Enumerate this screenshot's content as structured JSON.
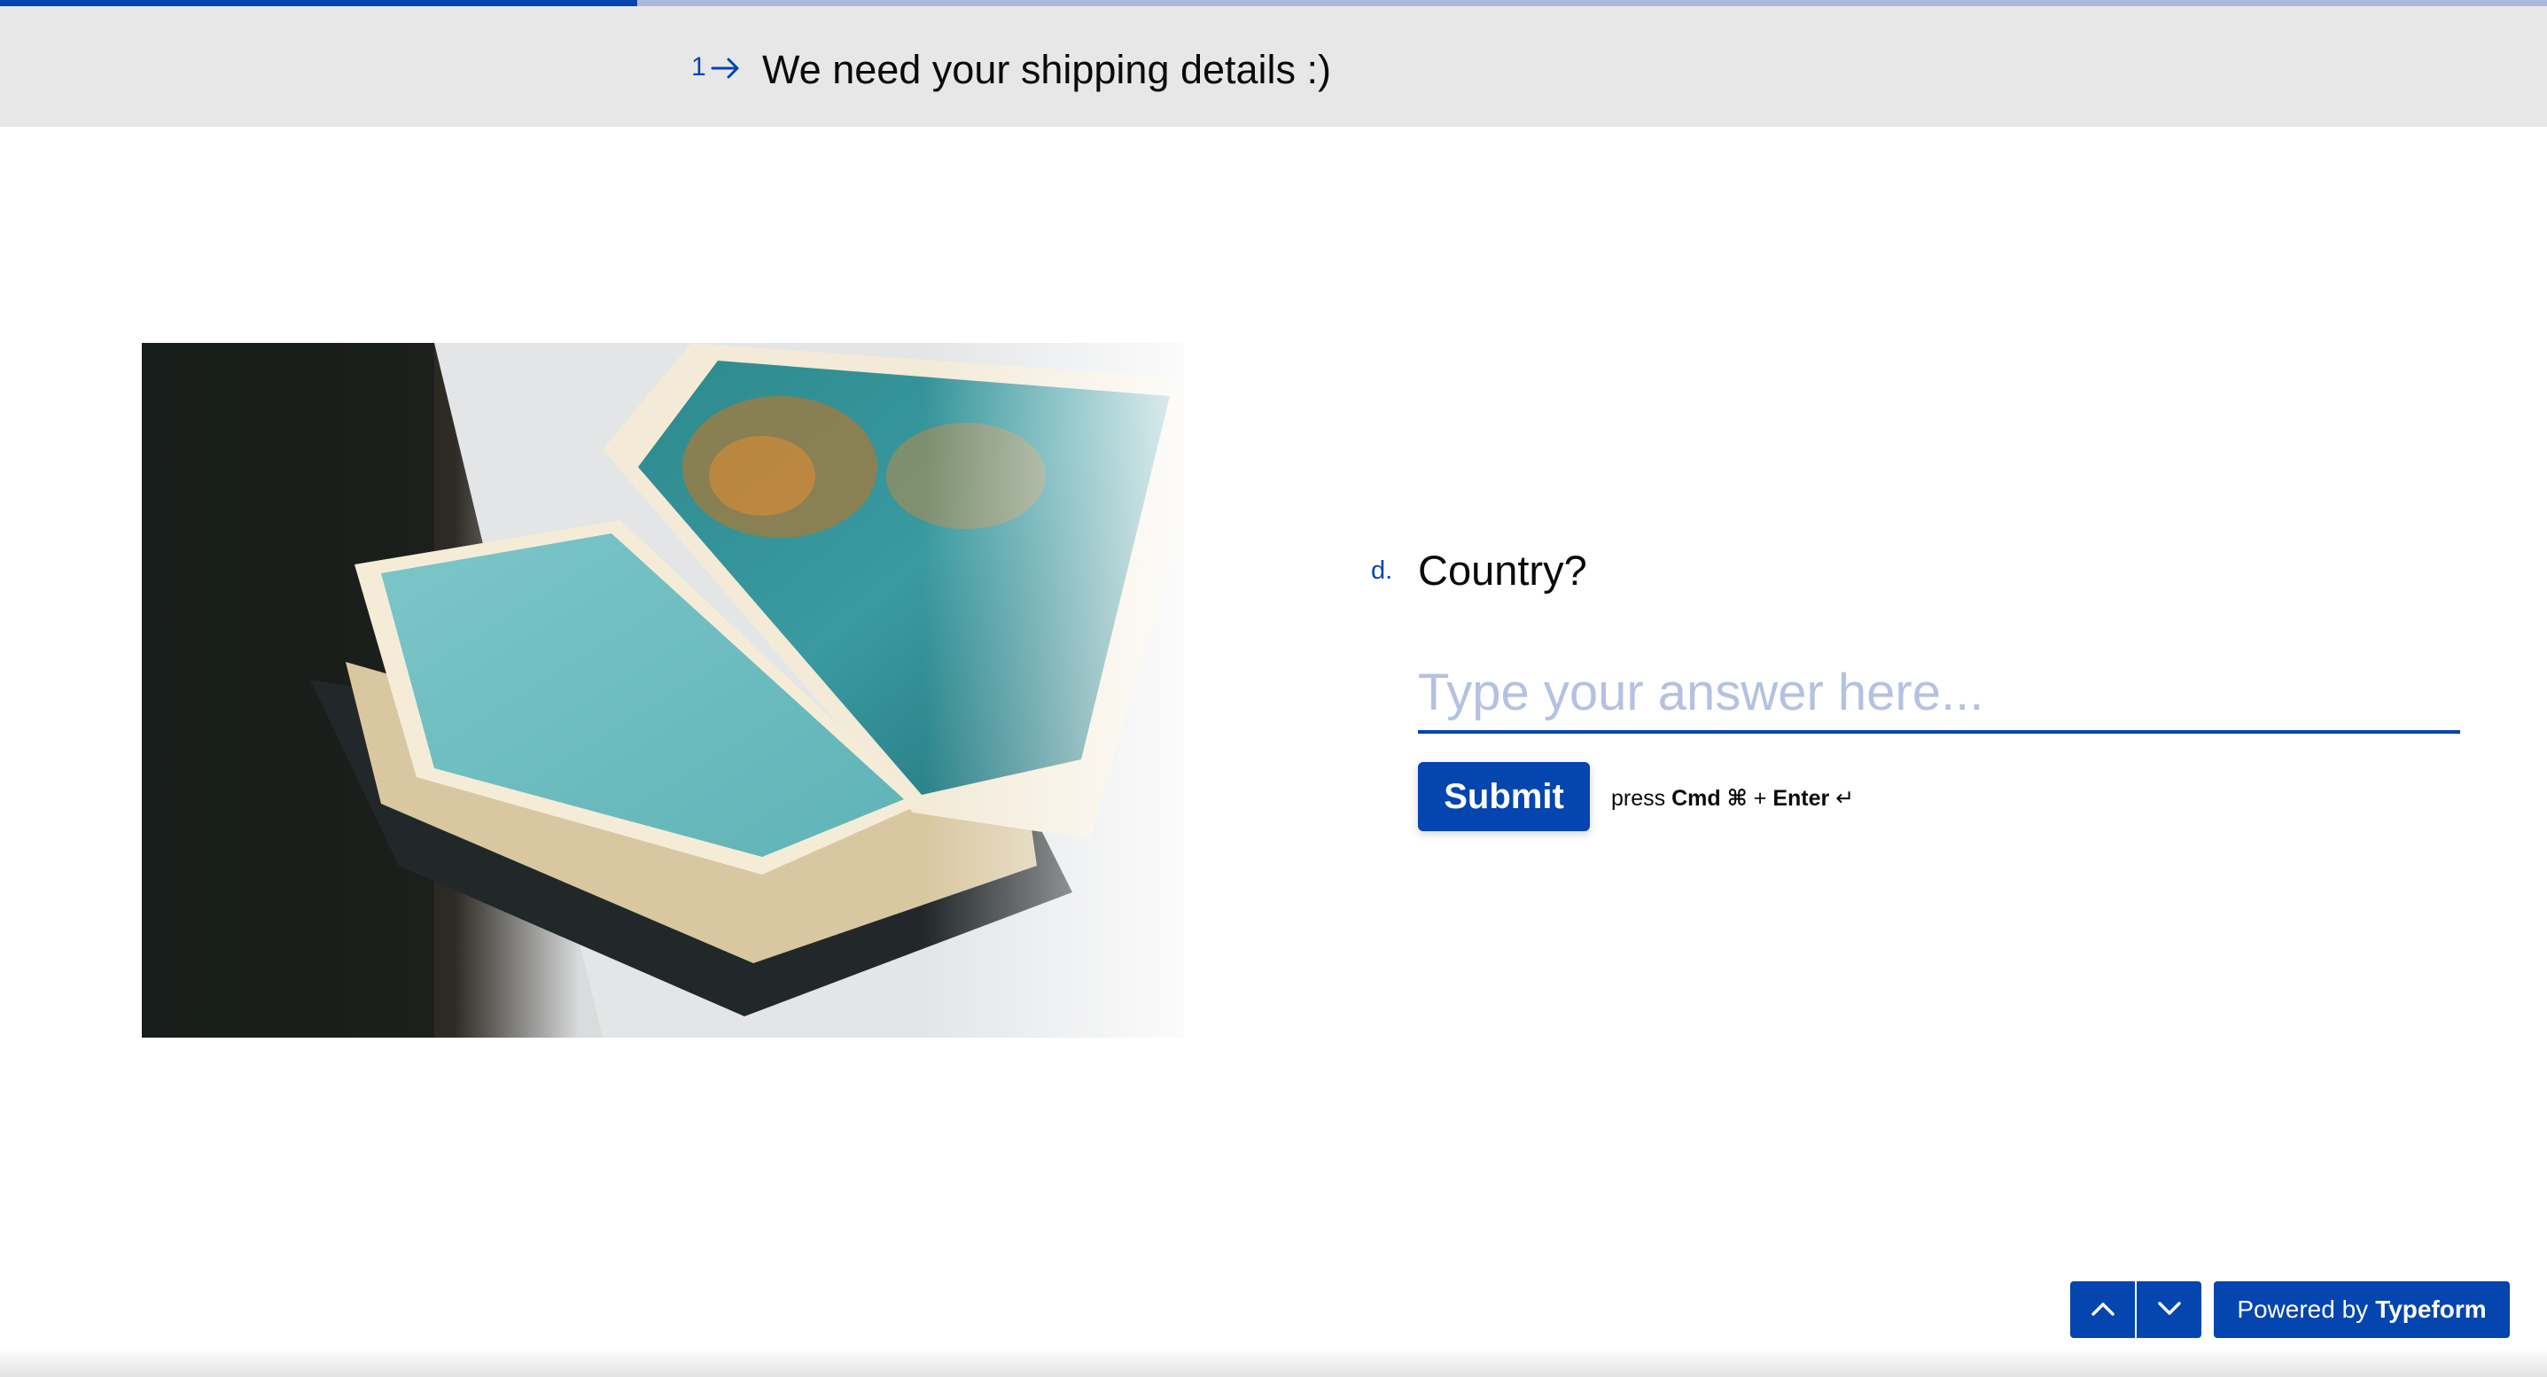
{
  "progress": {
    "fraction": 0.25,
    "fill_color": "#0445af",
    "track_color": "#aeb8dd"
  },
  "header": {
    "step_number": "1",
    "arrow_icon": "arrow-right-icon",
    "title": "We need your shipping details :)"
  },
  "image": {
    "subject": "open-atlas-book-photo"
  },
  "question": {
    "letter": "d.",
    "text": "Country?",
    "placeholder": "Type your answer here...",
    "value": ""
  },
  "submit": {
    "label": "Submit"
  },
  "hint": {
    "prefix": "press",
    "key1": "Cmd ⌘",
    "plus": "+",
    "key2": "Enter",
    "enter_symbol": "↵"
  },
  "navigation": {
    "up_icon": "chevron-up-icon",
    "down_icon": "chevron-down-icon"
  },
  "branding": {
    "powered_by": "Powered by",
    "brand": "Typeform"
  },
  "colors": {
    "accent": "#0445af",
    "header_bg": "#e7e7e7",
    "placeholder": "#b4c1e2"
  }
}
